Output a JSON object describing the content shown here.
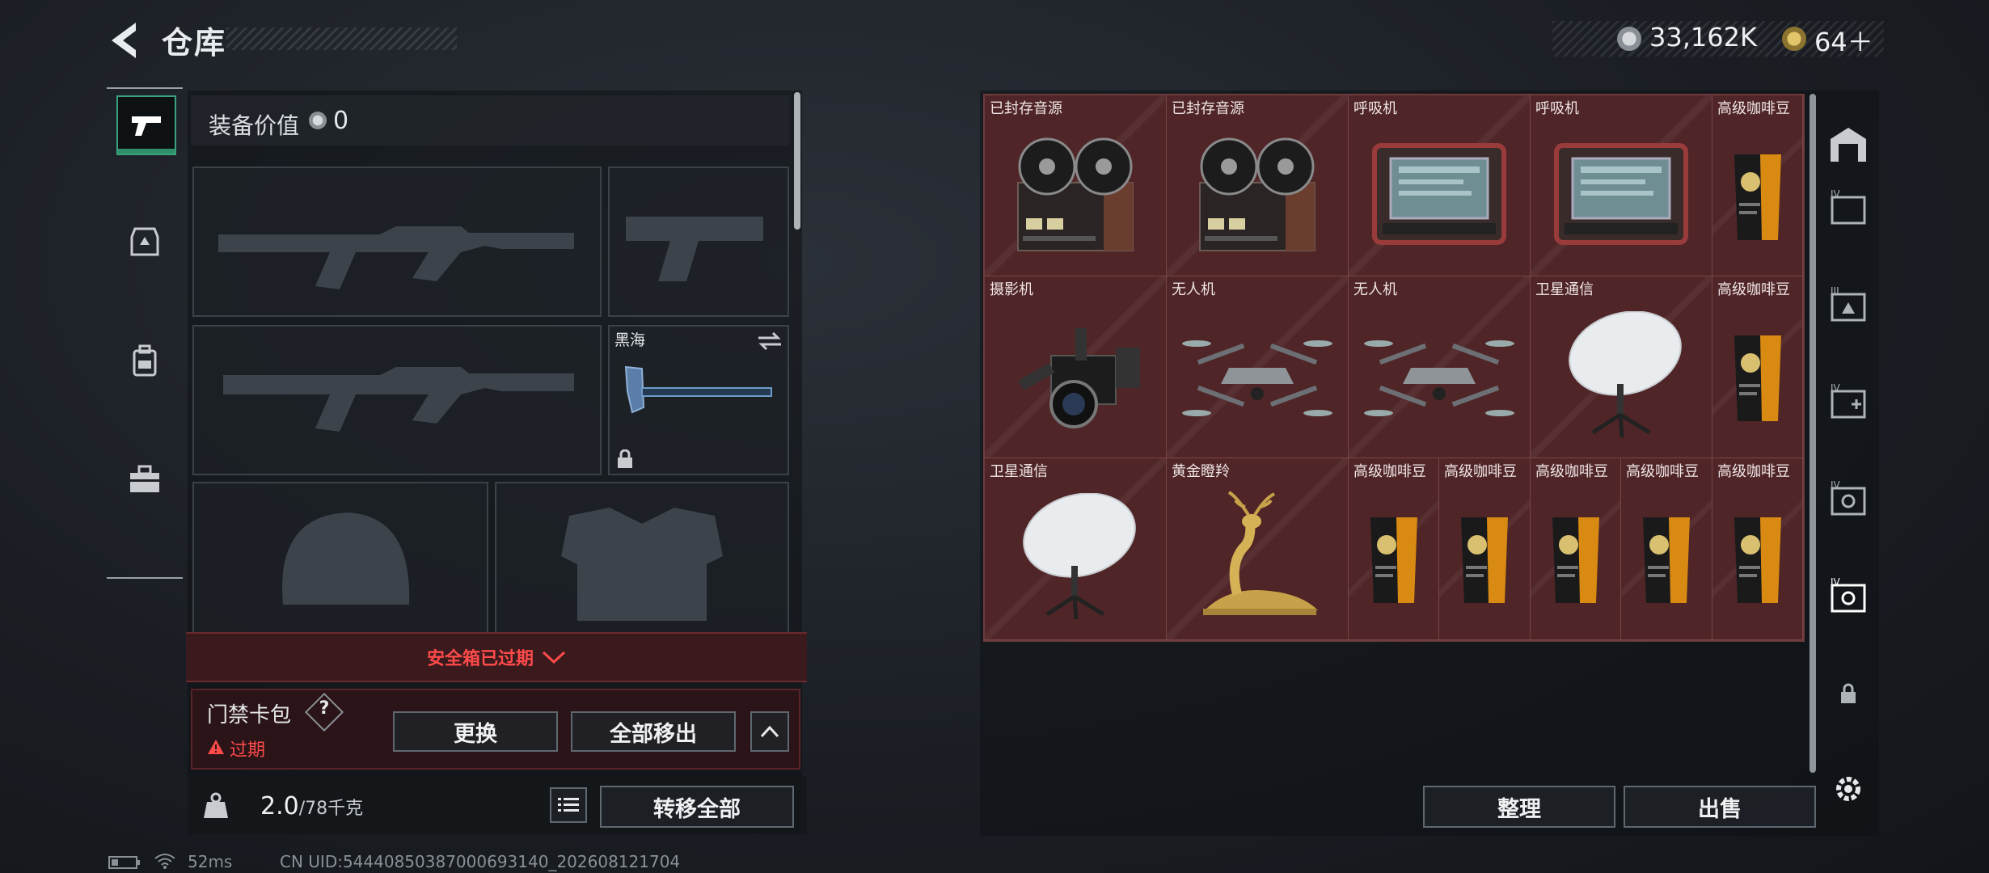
{
  "header": {
    "title": "仓库",
    "currency_primary": "33,162K",
    "currency_secondary": "64＋"
  },
  "left_panel": {
    "equipment_value_label": "装备价值",
    "equipment_value": "0",
    "melee_slot_name": "黑海",
    "expired_banner": "安全箱已过期",
    "card_pack_label": "门禁卡包",
    "card_pack_help": "?",
    "card_pack_status": "过期",
    "replace_button": "更换",
    "remove_all_button": "全部移出",
    "weight_current": "2.0",
    "weight_max": "/78千克",
    "transfer_all_button": "转移全部"
  },
  "grid": {
    "items": [
      {
        "label": "已封存音源",
        "icon": "reel-recorder-icon"
      },
      {
        "label": "已封存音源",
        "icon": "reel-recorder-icon"
      },
      {
        "label": "呼吸机",
        "icon": "ventilator-icon"
      },
      {
        "label": "呼吸机",
        "icon": "ventilator-icon"
      },
      {
        "label": "高级咖啡豆",
        "icon": "coffee-bag-icon"
      },
      {
        "label": "摄影机",
        "icon": "camera-icon"
      },
      {
        "label": "无人机",
        "icon": "drone-icon"
      },
      {
        "label": "无人机",
        "icon": "drone-icon"
      },
      {
        "label": "卫星通信",
        "icon": "satellite-dish-icon"
      },
      {
        "label": "高级咖啡豆",
        "icon": "coffee-bag-icon"
      },
      {
        "label": "卫星通信",
        "icon": "satellite-dish-icon"
      },
      {
        "label": "黄金瞪羚",
        "icon": "golden-gazelle-icon"
      },
      {
        "label": "高级咖啡豆",
        "icon": "coffee-bag-icon"
      },
      {
        "label": "高级咖啡豆",
        "icon": "coffee-bag-icon"
      },
      {
        "label": "高级咖啡豆",
        "icon": "coffee-bag-icon"
      },
      {
        "label": "高级咖啡豆",
        "icon": "coffee-bag-icon"
      },
      {
        "label": "高级咖啡豆",
        "icon": "coffee-bag-icon"
      }
    ]
  },
  "actions": {
    "sort_button": "整理",
    "sell_button": "出售"
  },
  "footer": {
    "ping": "52ms",
    "uid": "CN UID:544408503870006931​40_202608121704"
  },
  "colors": {
    "grid_bg": "#5a2a2c",
    "expired_red": "#ff4a4a",
    "active_tab_green": "#3aa27e"
  }
}
